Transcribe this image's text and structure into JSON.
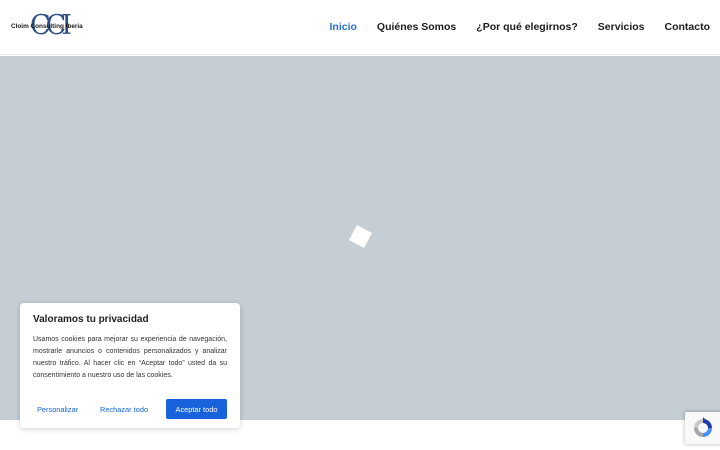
{
  "brand": {
    "logo_mark": "CCI",
    "logo_text": "Cloim Consulting Iberia"
  },
  "nav": {
    "items": [
      {
        "label": "Inicio",
        "active": true
      },
      {
        "label": "Quiénes Somos",
        "active": false
      },
      {
        "label": "¿Por qué elegirnos?",
        "active": false
      },
      {
        "label": "Servicios",
        "active": false
      },
      {
        "label": "Contacto",
        "active": false
      }
    ],
    "active_color": "#2a6fd6"
  },
  "hero": {
    "background": "#c4ced4",
    "loader_icon": "loading-square-icon"
  },
  "cookie_banner": {
    "title": "Valoramos tu privacidad",
    "text": "Usamos cookies para mejorar su experiencia de navegación, mostrarle anuncios o contenidos personalizados y analizar nuestro tráfico. Al hacer clic en “Aceptar todo” usted da su consentimiento a nuestro uso de las cookies.",
    "customize_label": "Personalizar",
    "reject_label": "Rechazar todo",
    "accept_label": "Aceptar todo",
    "accent_color": "#1863dc"
  },
  "recaptcha": {
    "icon": "recaptcha-icon"
  }
}
